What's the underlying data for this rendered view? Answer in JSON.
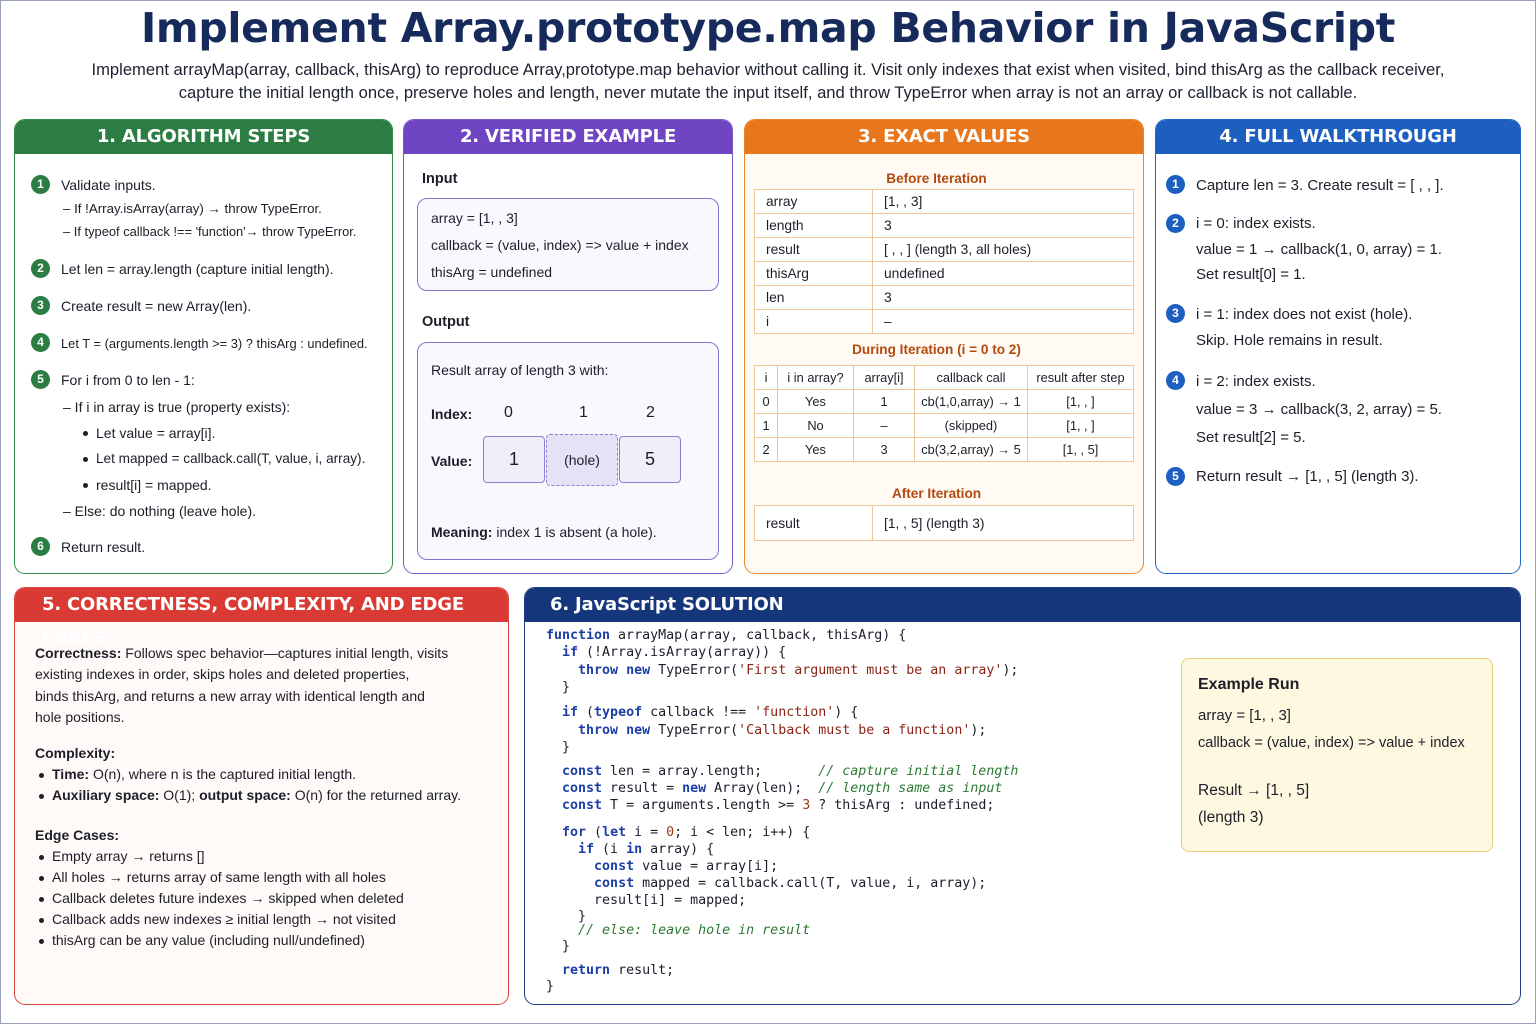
{
  "title": "Implement Array.prototype.map Behavior in JavaScript",
  "subtitle_lines": [
    "Implement arrayMap(array, callback, thisArg) to reproduce Array,prototype.map behavior without calling it. Visit only indexes that exist when visited, bind thisArg as the callback receiver,",
    "capture the initial length once, preserve holes and length, never mutate the input itself, and throw TypeError when array is not an array or callback is not callable."
  ],
  "panel1": {
    "header": "1. ALGORITHM STEPS",
    "step1": "Validate inputs.",
    "step1a": "– If !Array.isArray(array) → throw TypeError.",
    "step1b": "– If typeof callback !== 'function'→ throw TypeError.",
    "step2": "Let len = array.length (capture initial length).",
    "step3": "Create result = new Array(len).",
    "step4": "Let T = (arguments.length >= 3) ? thisArg : undefined.",
    "step5": "For i from 0 to len - 1:",
    "step5a": "– If i in array is true (property exists):",
    "step5b": "Let value = array[i].",
    "step5c": "Let mapped = callback.call(T, value, i, array).",
    "step5d": "result[i] = mapped.",
    "step5e": "– Else: do nothing (leave hole).",
    "step6": "Return result.",
    "numbers": [
      "1",
      "2",
      "3",
      "4",
      "5",
      "6"
    ]
  },
  "panel2": {
    "header": "2. VERIFIED EXAMPLE",
    "input_label": "Input",
    "input_lines": [
      "array = [1, , 3]",
      "callback = (value, index) => value + index",
      "thisArg = undefined"
    ],
    "output_label": "Output",
    "result_desc": "Result array of length 3 with:",
    "index_label": "Index:",
    "indexes": [
      "0",
      "1",
      "2"
    ],
    "value_label": "Value:",
    "values": [
      "1",
      "(hole)",
      "5"
    ],
    "meaning_label": "Meaning:",
    "meaning_text": "index 1 is absent (a hole)."
  },
  "panel3": {
    "header": "3. EXACT VALUES",
    "before_label": "Before Iteration",
    "before_rows": [
      [
        "array",
        "[1,  ,  3]"
      ],
      [
        "length",
        "3"
      ],
      [
        "result",
        "[  ,  ,  ]  (length 3, all holes)"
      ],
      [
        "thisArg",
        "undefined"
      ],
      [
        "len",
        "3"
      ],
      [
        "i",
        "–"
      ]
    ],
    "during_label": "During Iteration (i = 0 to 2)",
    "during_headers": [
      "i",
      "i in array?",
      "array[i]",
      "callback call",
      "result after step"
    ],
    "during_rows": [
      [
        "0",
        "Yes",
        "1",
        "cb(1,0,array) → 1",
        "[1,  ,  ]"
      ],
      [
        "1",
        "No",
        "–",
        "(skipped)",
        "[1,  ,  ]"
      ],
      [
        "2",
        "Yes",
        "3",
        "cb(3,2,array) → 5",
        "[1,  ,  5]"
      ]
    ],
    "after_label": "After Iteration",
    "after_row": [
      "result",
      "[1,  ,  5]  (length 3)"
    ]
  },
  "panel4": {
    "header": "4. FULL WALKTHROUGH",
    "numbers": [
      "1",
      "2",
      "3",
      "4",
      "5"
    ],
    "s1": "Capture len = 3. Create result = [ , , ].",
    "s2a": "i = 0: index exists.",
    "s2b": "value = 1 → callback(1, 0, array) = 1.",
    "s2c": "Set result[0] = 1.",
    "s3a": "i = 1: index does not exist (hole).",
    "s3b": "Skip. Hole remains in result.",
    "s4a": "i = 2: index exists.",
    "s4b": "value = 3 → callback(3, 2, array) = 5.",
    "s4c": "Set result[2] = 5.",
    "s5": "Return result → [1,  ,  5] (length 3)."
  },
  "panel5": {
    "header": "5. CORRECTNESS, COMPLEXITY, AND EDGE CASES",
    "correctness_label": "Correctness:",
    "correctness_lines": [
      "Follows spec behavior—captures initial length, visits",
      "existing indexes in order, skips holes and deleted properties,",
      "binds thisArg, and returns a new array with identical length and",
      "hole positions."
    ],
    "complexity_label": "Complexity:",
    "time_label": "Time:",
    "time_text": "O(n), where n is the captured initial length.",
    "aux_label": "Auxiliary space:",
    "aux_text": "O(1);",
    "out_label": "output space:",
    "out_text": "O(n) for the returned array.",
    "edge_label": "Edge Cases:",
    "edge_cases": [
      "Empty array → returns []",
      "All holes → returns array of same length with all holes",
      "Callback deletes future indexes → skipped when deleted",
      "Callback adds new indexes ≥ initial length → not visited",
      "thisArg can be any value (including null/undefined)"
    ]
  },
  "panel6": {
    "header": "6. JavaScript SOLUTION",
    "code": {
      "l1": "function arrayMap(array, callback, thisArg) {",
      "l2": "  if (!Array.isArray(array)) {",
      "l3": "    throw new TypeError('First argument must be an array');",
      "l4": "  }",
      "l5": "  if (typeof callback !== 'function') {",
      "l6": "    throw new TypeError('Callback must be a function');",
      "l7": "  }",
      "l8": "  const len = array.length;       // capture initial length",
      "l9": "  const result = new Array(len);  // length same as input",
      "l10": "  const T = arguments.length >= 3 ? thisArg : undefined;",
      "l11": "  for (let i = 0; i < len; i++) {",
      "l12": "    if (i in array) {",
      "l13": "      const value = array[i];",
      "l14": "      const mapped = callback.call(T, value, i, array);",
      "l15": "      result[i] = mapped;",
      "l16": "    }",
      "l17": "    // else: leave hole in result",
      "l18": "  }",
      "l19": "  return result;",
      "l20": "}"
    },
    "example": {
      "title": "Example Run",
      "array": "array = [1,  ,  3]",
      "callback": "callback = (value, index) => value + index",
      "result": "Result → [1,  ,  5]",
      "length": "(length 3)"
    }
  }
}
